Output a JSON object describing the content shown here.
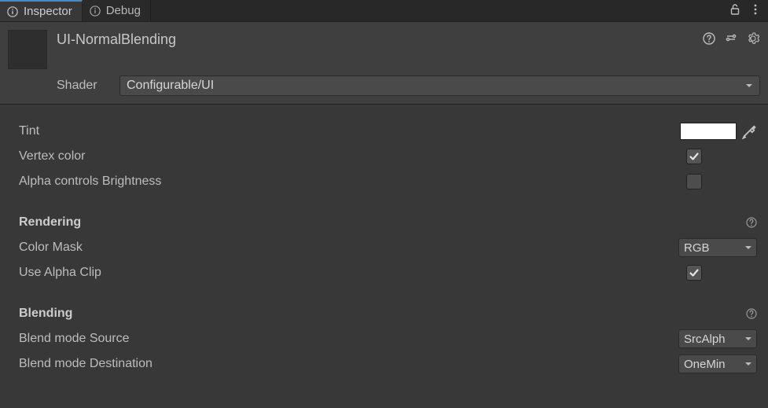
{
  "tabs": {
    "inspector": "Inspector",
    "debug": "Debug"
  },
  "material": {
    "name": "UI-NormalBlending",
    "shader_label": "Shader",
    "shader_value": "Configurable/UI"
  },
  "props": {
    "tint_label": "Tint",
    "tint_color": "#ffffff",
    "vertex_color_label": "Vertex color",
    "vertex_color_value": true,
    "alpha_brightness_label": "Alpha controls Brightness",
    "alpha_brightness_value": false
  },
  "rendering": {
    "header": "Rendering",
    "color_mask_label": "Color Mask",
    "color_mask_value": "RGB",
    "use_alpha_clip_label": "Use Alpha Clip",
    "use_alpha_clip_value": true
  },
  "blending": {
    "header": "Blending",
    "src_label": "Blend mode Source",
    "src_value": "SrcAlph",
    "dst_label": "Blend mode Destination",
    "dst_value": "OneMin"
  }
}
